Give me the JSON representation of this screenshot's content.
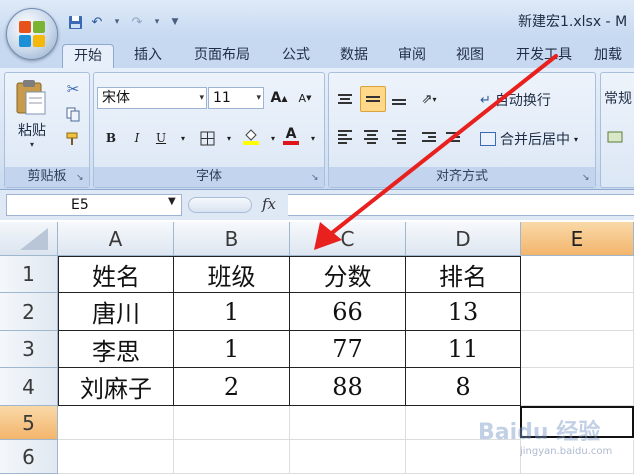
{
  "window": {
    "title": "新建宏1.xlsx - M"
  },
  "tabs": [
    "开始",
    "插入",
    "页面布局",
    "公式",
    "数据",
    "审阅",
    "视图",
    "开发工具",
    "加载"
  ],
  "clipboard": {
    "paste_label": "粘贴",
    "group_label": "剪贴板"
  },
  "font": {
    "name": "宋体",
    "size": "11",
    "group_label": "字体",
    "bold": "B",
    "italic": "I",
    "underline": "U",
    "font_color_letter": "A",
    "grow": "A",
    "shrink": "A"
  },
  "alignment": {
    "wrap_text": "自动换行",
    "merge_center": "合并后居中",
    "group_label": "对齐方式"
  },
  "number": {
    "format": "常规"
  },
  "formula_bar": {
    "name_box": "E5",
    "fx": "fx",
    "value": ""
  },
  "columns": [
    "A",
    "B",
    "C",
    "D",
    "E"
  ],
  "rows": [
    "1",
    "2",
    "3",
    "4",
    "5",
    "6"
  ],
  "table": {
    "headers": [
      "姓名",
      "班级",
      "分数",
      "排名"
    ],
    "rows": [
      [
        "唐川",
        "1",
        "66",
        "13"
      ],
      [
        "李思",
        "1",
        "77",
        "11"
      ],
      [
        "刘麻子",
        "2",
        "88",
        "8"
      ]
    ]
  },
  "selection": {
    "active_cell": "E5",
    "active_column": "E",
    "active_row": "5"
  },
  "annotation": {
    "color": "#e8201e"
  },
  "watermark": {
    "text": "Baidu 经验",
    "sub": "jingyan.baidu.com"
  },
  "colors": {
    "ribbon_tab_bg": "#c6d9f1",
    "selected_header": "#f3b56c",
    "cell_border": "#222222"
  }
}
